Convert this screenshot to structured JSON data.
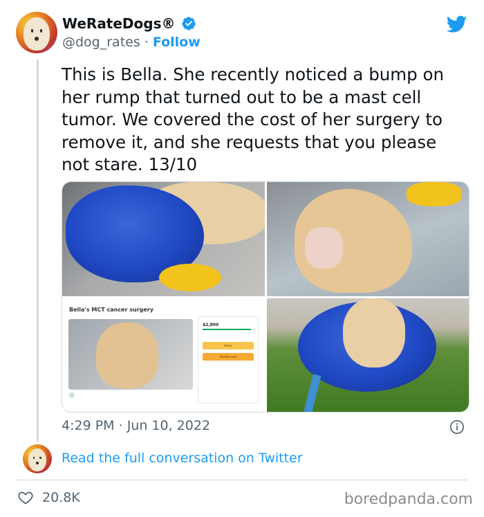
{
  "author": {
    "display_name": "WeRateDogs®",
    "handle": "@dog_rates",
    "separator": "·",
    "follow_label": "Follow",
    "verified": true
  },
  "tweet": {
    "text": "This is Bella. She recently noticed a bump on\nher rump that turned out to be a mast cell\ntumor. We covered the cost of her surgery to\nremove it, and she requests that you please\nnot stare. 13/10",
    "time": "4:29 PM",
    "date": "Jun 10, 2022"
  },
  "media": {
    "screenshot_title": "Bella's MCT cancer surgery",
    "screenshot_amount": "$2,800",
    "screenshot_share": "Share",
    "screenshot_donate": "Donate now"
  },
  "footer": {
    "read_link": "Read the full conversation on Twitter",
    "likes": "20.8K",
    "watermark": "boredpanda.com"
  },
  "colors": {
    "accent": "#1d9bf0",
    "text": "#0f1419",
    "muted": "#536471"
  },
  "icons": {
    "brand": "twitter-bird-icon",
    "verified": "verified-badge-icon",
    "info": "info-icon",
    "like": "heart-icon"
  }
}
